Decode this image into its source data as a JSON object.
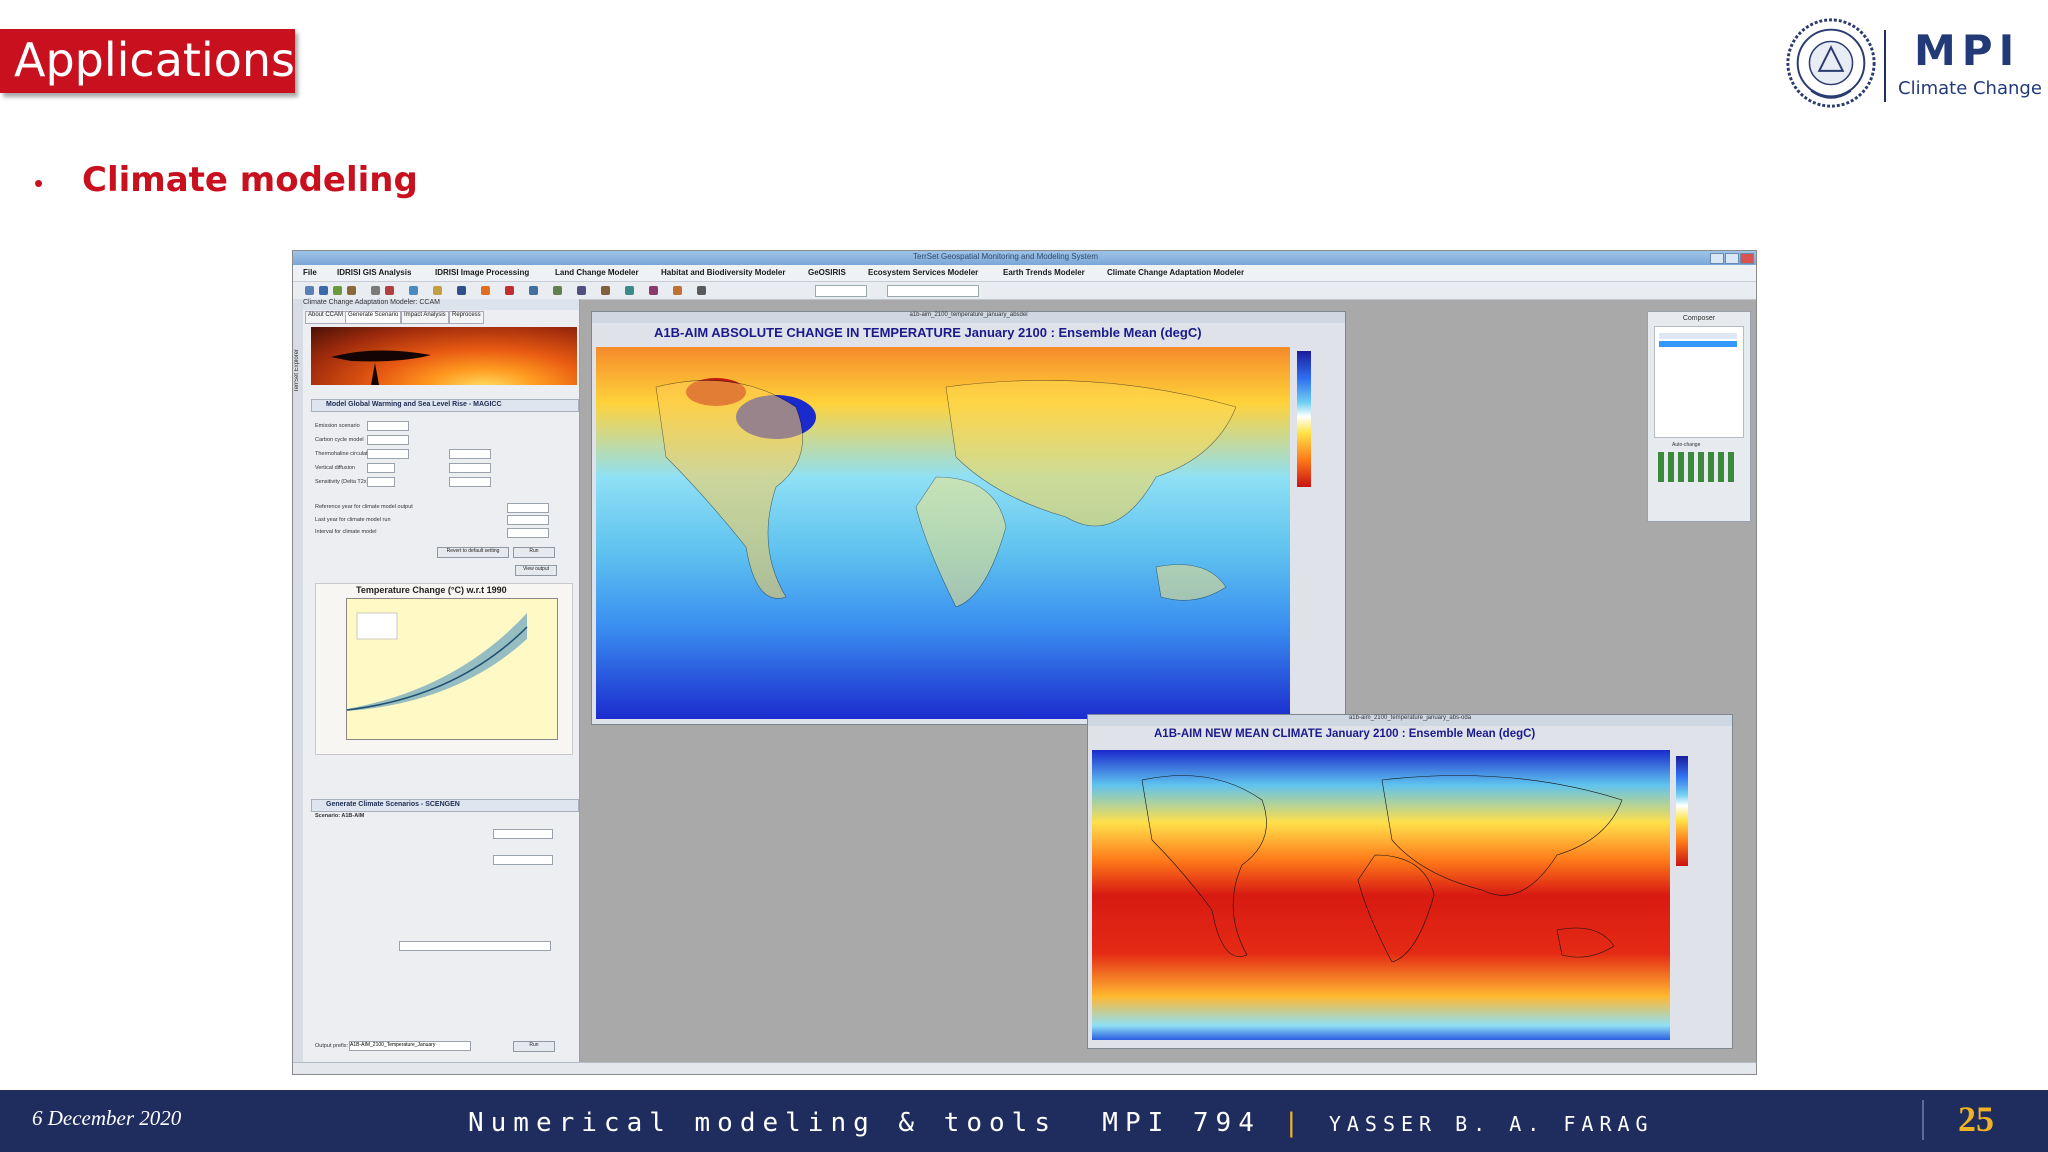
{
  "slide": {
    "title": "Applications",
    "bullet": "Climate modeling",
    "logo": {
      "name": "MPI",
      "subtitle": "Climate Change",
      "seal_icon": "university-seal-icon"
    },
    "footer": {
      "date": "6 December 2020",
      "course": "Numerical modeling & tools  MPI 794",
      "separator": "|",
      "author": "YASSER B. A. FARAG",
      "page": "25"
    },
    "colors": {
      "accent_red": "#c8101e",
      "footer_navy": "#1e2c5e",
      "footer_gold": "#f0b323",
      "logo_blue": "#233a78"
    }
  },
  "screenshot": {
    "window_title": "TerrSet Geospatial Monitoring and Modeling System",
    "menu": [
      "File",
      "IDRISI GIS Analysis",
      "IDRISI Image Processing",
      "Land Change Modeler",
      "Habitat and Biodiversity Modeler",
      "GeOSIRIS",
      "Ecosystem Services Modeler",
      "Earth Trends Modeler",
      "Climate Change Adaptation Modeler"
    ],
    "left_panel": {
      "header": "Climate Change Adaptation Modeler: CCAM",
      "tabs": [
        "About CCAM",
        "Generate Scenario",
        "Impact Analysis",
        "Reprocess"
      ],
      "side_label": "TerrSet Explorer",
      "section1": "Model Global Warming and Sea Level Rise - MAGICC",
      "rows": [
        "Emission scenario",
        "Carbon cycle model",
        "Thermohaline circulation",
        "Vertical diffusion",
        "Sensitivity (Delta T2x)"
      ],
      "output_rows": [
        "Reference year for climate model output",
        "Last year for climate model run",
        "Interval for climate model"
      ],
      "buttons": {
        "reset": "Revert to default setting",
        "run": "Run",
        "view": "View output"
      },
      "chart_title": "Temperature Change (°C) w.r.t 1990",
      "section2": "Generate Climate Scenarios - SCENGEN",
      "scenario": "Scenario:  A1B-AIM",
      "output_prefix": "Output prefix:",
      "output_value": "A1B-AIM_2100_Temperature_January",
      "run2": "Run"
    },
    "map1": {
      "file": "a1b-aim_2100_temperature_january_absdel",
      "title": "A1B-AIM ABSOLUTE CHANGE IN TEMPERATURE January 2100 : Ensemble Mean (degC)"
    },
    "map2": {
      "file": "a1b-aim_2100_temperature_january_abs-oda",
      "title": "A1B-AIM NEW MEAN CLIMATE January 2100 : Ensemble Mean (degC)"
    },
    "composer": {
      "title": "Composer",
      "auto_label": "Auto-change"
    }
  }
}
